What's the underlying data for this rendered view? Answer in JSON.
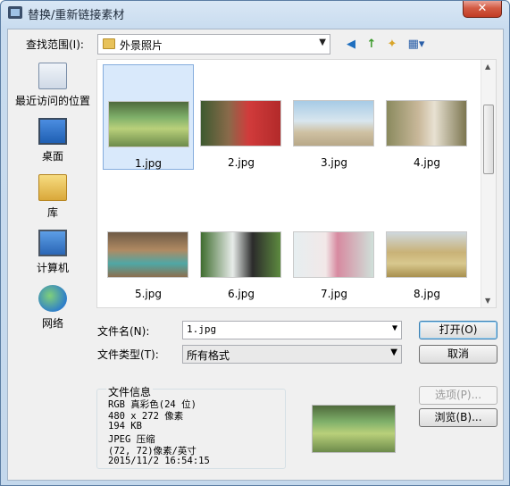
{
  "window": {
    "title": "替换/重新链接素材",
    "close_glyph": "✕"
  },
  "toolbar": {
    "lookin_label": "查找范围(I):",
    "lookin_value": "外景照片",
    "back_glyph": "◀",
    "up_glyph": "↑",
    "newfolder_glyph": "✦",
    "views_glyph": "▦▾"
  },
  "places": [
    {
      "label": "最近访问的位置",
      "icon": "recent-places-icon"
    },
    {
      "label": "桌面",
      "icon": "desktop-icon"
    },
    {
      "label": "库",
      "icon": "libraries-icon"
    },
    {
      "label": "计算机",
      "icon": "computer-icon"
    },
    {
      "label": "网络",
      "icon": "network-icon"
    }
  ],
  "files": [
    {
      "name": "1.jpg",
      "selected": true
    },
    {
      "name": "2.jpg"
    },
    {
      "name": "3.jpg"
    },
    {
      "name": "4.jpg"
    },
    {
      "name": "5.jpg"
    },
    {
      "name": "6.jpg"
    },
    {
      "name": "7.jpg"
    },
    {
      "name": "8.jpg"
    }
  ],
  "form": {
    "filename_label": "文件名(N):",
    "filename_value": "1.jpg",
    "filetype_label": "文件类型(T):",
    "filetype_value": "所有格式"
  },
  "buttons": {
    "open": "打开(O)",
    "cancel": "取消",
    "options": "选项(P)...",
    "browse": "浏览(B)..."
  },
  "fileinfo": {
    "title": "文件信息",
    "lines": [
      "RGB 真彩色(24 位)",
      "480 x 272 像素",
      "194 KB",
      "JPEG 压缩",
      "(72, 72)像素/英寸",
      "2015/11/2  16:54:15"
    ]
  },
  "colors": {
    "selection": "#d9e9fb",
    "titlebar": "#c9dcef",
    "close": "#c03b24"
  }
}
